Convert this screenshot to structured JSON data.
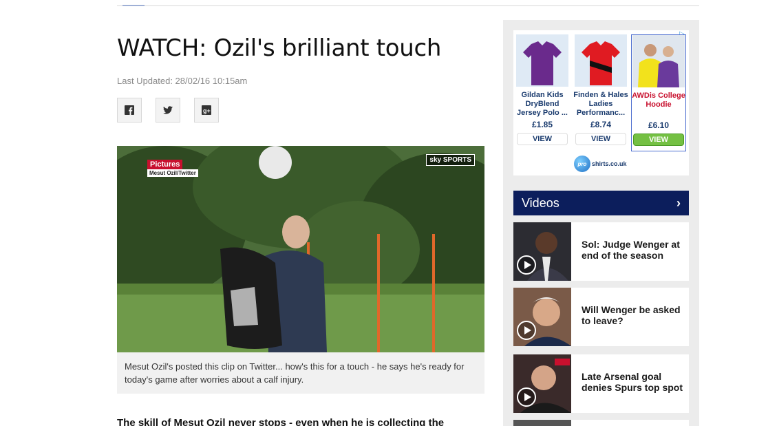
{
  "article": {
    "title": "WATCH: Ozil's brilliant touch",
    "last_updated": "Last Updated: 28/02/16 10:15am",
    "share_icons": [
      "facebook-icon",
      "twitter-icon",
      "google-plus-icon"
    ],
    "video": {
      "label": "Pictures",
      "credit": "Mesut Ozil/Twitter",
      "brand": "sky SPORTS"
    },
    "caption": "Mesut Ozil's posted this clip on Twitter... how's this for a touch - he says he's ready for today's game after worries about a calf injury.",
    "body_start": "The skill of Mesut Ozil never stops - even when he is collecting the"
  },
  "ad": {
    "items": [
      {
        "name": "Gildan Kids DryBlend Jersey Polo ...",
        "price": "£1.85",
        "view": "VIEW",
        "color": "#6a2a8c"
      },
      {
        "name": "Finden & Hales Ladies Performanc...",
        "price": "£8.74",
        "view": "VIEW",
        "color": "#e01b22"
      },
      {
        "name": "AWDis College Hoodie",
        "price": "£6.10",
        "view": "VIEW",
        "color": "#f2e21c"
      }
    ],
    "logo_text": "shirts.co.uk",
    "logo_mark": "pro"
  },
  "videos": {
    "header": "Videos",
    "items": [
      {
        "title": "Sol: Judge Wenger at end of the season"
      },
      {
        "title": "Will Wenger be asked to leave?"
      },
      {
        "title": "Late Arsenal goal denies Spurs top spot"
      }
    ]
  }
}
